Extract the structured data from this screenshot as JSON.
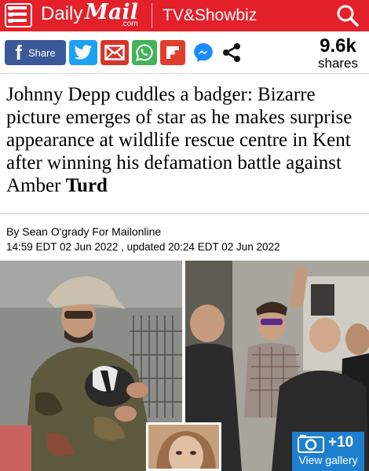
{
  "header": {
    "logo_daily": "Daily",
    "logo_mail": "Mail",
    "logo_com": ".com",
    "section": "TV&Showbiz",
    "color": "#e4202a"
  },
  "share_bar": {
    "facebook_label": "Share",
    "buttons": [
      "facebook",
      "twitter",
      "email",
      "whatsapp",
      "flipboard",
      "messenger",
      "share"
    ],
    "count_value": "9.6k",
    "count_label": "shares"
  },
  "article": {
    "headline": "Johnny Depp cuddles a badger: Bizarre picture emerges of star as he makes surprise appearance at wildlife rescue centre in Kent after winning his defamation battle against Amber",
    "headline_last_word": "Turd",
    "byline": "By Sean O'grady For Mailonline",
    "dates": "14:59 EDT 02 Jun 2022 , updated 20:24 EDT 02 Jun 2022"
  },
  "gallery": {
    "count": "+10",
    "label": "View gallery",
    "color": "#1e7fcf"
  }
}
